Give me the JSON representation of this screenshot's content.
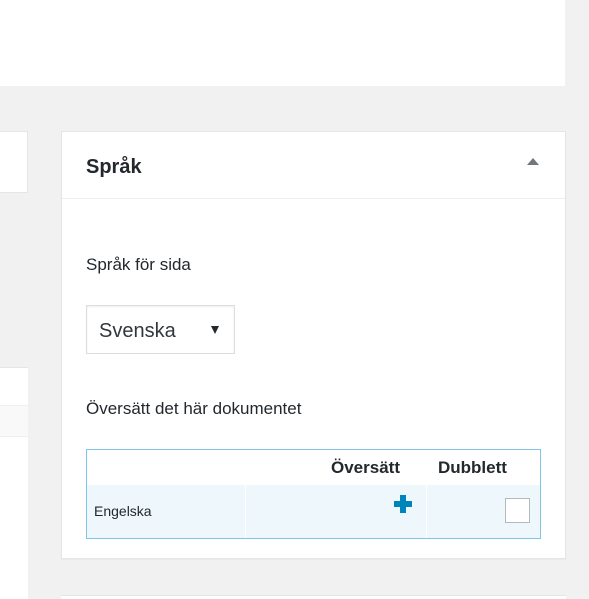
{
  "panel": {
    "title": "Språk",
    "language_label": "Språk för sida",
    "language_select": {
      "value": "Svenska"
    },
    "translate_heading": "Översätt det här dokumentet",
    "translations_table": {
      "headers": [
        "",
        "Översätt",
        "Dubblett"
      ],
      "rows": [
        {
          "language": "Engelska",
          "translate_icon": "plus-icon",
          "duplicate_checked": false
        }
      ]
    }
  },
  "colors": {
    "background": "#f1f1f1",
    "panel": "#ffffff",
    "border": "#e5e5e5",
    "table_border": "#7fc5e8",
    "row_highlight": "#eef7fc",
    "accent": "#0085ba"
  }
}
